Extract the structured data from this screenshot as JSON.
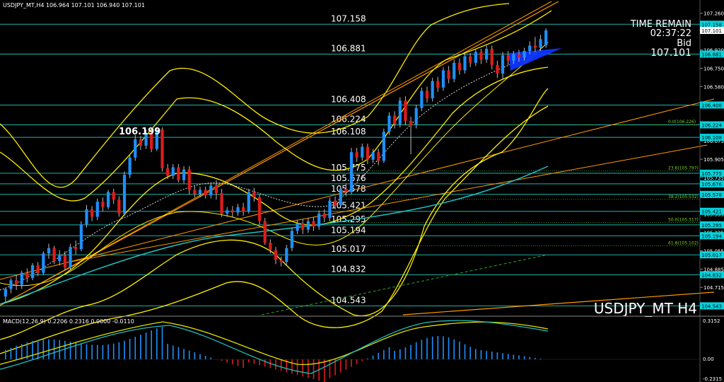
{
  "header": {
    "symbol_info": "USDJPY_MT,H4",
    "ohlc": "106.964 107.101 106.940 107.101"
  },
  "info": {
    "time_remain_label": "TIME REMAIN",
    "time_remain": "02:37:22",
    "bid_label": "Bid",
    "bid": "107.101"
  },
  "watermark": "USDJPY_MT H4",
  "highlight_label": "106.199",
  "macd": {
    "label": "MACD(12,26,9) 0.2206 0.2316 0.0000 -0.0110",
    "axis_labels": [
      "0.3152",
      "0.00",
      "-0.2315"
    ]
  },
  "colors": {
    "background": "#000000",
    "bull": "#1e90ff",
    "bear": "#e01c1c",
    "level": "#20b2aa",
    "bollinger": "#ffee00",
    "trend": "#ff9900",
    "ma": "#1fbfbf",
    "fib": "#7ed321",
    "axis_tag": "#00d5e0",
    "macd_signal": "#e0e000"
  },
  "chart_data": {
    "type": "candlestick",
    "ylim": [
      104.46,
      107.37
    ],
    "axis_labels": [
      "107.260",
      "107.090",
      "106.920",
      "106.750",
      "106.580",
      "106.405",
      "106.245",
      "106.075",
      "105.905",
      "105.735",
      "105.565",
      "105.395",
      "105.225",
      "105.055",
      "104.885",
      "104.715"
    ],
    "levels": [
      {
        "value": "107.158",
        "tag": "107.158"
      },
      {
        "value": "106.881",
        "tag": "106.881"
      },
      {
        "value": "106.408",
        "tag": "106.408"
      },
      {
        "value": "106.224",
        "tag": "106.224"
      },
      {
        "value": "106.108",
        "tag": "106.108"
      },
      {
        "value": "105.775",
        "tag": "105.775"
      },
      {
        "value": "105.676",
        "tag": "105.676"
      },
      {
        "value": "105.578",
        "tag": "105.578"
      },
      {
        "value": "105.421",
        "tag": "105.421"
      },
      {
        "value": "105.295",
        "tag": "105.295"
      },
      {
        "value": "105.194",
        "tag": "105.194"
      },
      {
        "value": "105.017",
        "tag": "105.017"
      },
      {
        "value": "104.832",
        "tag": "104.832"
      },
      {
        "value": "104.543",
        "tag": "104.543"
      }
    ],
    "fib_levels": [
      {
        "label": "0.0(106.226)",
        "value": 106.226
      },
      {
        "label": "23.6(105.797)",
        "value": 105.797
      },
      {
        "label": "38.2(105.532)",
        "value": 105.532
      },
      {
        "label": "50.0(105.317)",
        "value": 105.317
      },
      {
        "label": "61.8(105.102)",
        "value": 105.102
      }
    ],
    "current_price": "107.101",
    "candles": [
      [
        104.63,
        104.7,
        104.57,
        104.71
      ],
      [
        104.7,
        104.78,
        104.66,
        104.8
      ],
      [
        104.78,
        104.74,
        104.69,
        104.83
      ],
      [
        104.74,
        104.85,
        104.7,
        104.87
      ],
      [
        104.85,
        104.8,
        104.76,
        104.89
      ],
      [
        104.8,
        104.92,
        104.78,
        104.94
      ],
      [
        104.92,
        104.85,
        104.82,
        104.95
      ],
      [
        104.85,
        105.03,
        104.83,
        105.05
      ],
      [
        105.03,
        105.08,
        104.98,
        105.12
      ],
      [
        105.08,
        104.96,
        104.93,
        105.1
      ],
      [
        104.96,
        105.01,
        104.92,
        105.06
      ],
      [
        105.01,
        104.9,
        104.87,
        105.05
      ],
      [
        104.9,
        105.09,
        104.88,
        105.12
      ],
      [
        105.09,
        105.07,
        105.02,
        105.15
      ],
      [
        105.07,
        105.3,
        105.05,
        105.33
      ],
      [
        105.3,
        105.44,
        105.27,
        105.48
      ],
      [
        105.44,
        105.37,
        105.33,
        105.47
      ],
      [
        105.37,
        105.51,
        105.34,
        105.54
      ],
      [
        105.51,
        105.46,
        105.42,
        105.55
      ],
      [
        105.46,
        105.6,
        105.44,
        105.62
      ],
      [
        105.6,
        105.53,
        105.49,
        105.63
      ],
      [
        105.53,
        105.4,
        105.37,
        105.56
      ],
      [
        105.4,
        105.76,
        105.38,
        105.79
      ],
      [
        105.76,
        105.92,
        105.73,
        105.95
      ],
      [
        105.92,
        106.09,
        105.89,
        106.13
      ],
      [
        106.09,
        106.03,
        105.99,
        106.12
      ],
      [
        106.03,
        106.15,
        106.0,
        106.18
      ],
      [
        106.15,
        106.0,
        105.97,
        106.17
      ],
      [
        106.0,
        106.18,
        105.98,
        106.2
      ],
      [
        106.18,
        105.82,
        105.79,
        106.2
      ],
      [
        105.82,
        105.75,
        105.72,
        105.86
      ],
      [
        105.75,
        105.83,
        105.72,
        105.86
      ],
      [
        105.83,
        105.71,
        105.69,
        105.86
      ],
      [
        105.71,
        105.81,
        105.68,
        105.84
      ],
      [
        105.81,
        105.62,
        105.58,
        105.84
      ],
      [
        105.62,
        105.58,
        105.55,
        105.66
      ],
      [
        105.58,
        105.62,
        105.55,
        105.65
      ],
      [
        105.62,
        105.57,
        105.54,
        105.65
      ],
      [
        105.57,
        105.66,
        105.54,
        105.68
      ],
      [
        105.66,
        105.59,
        105.53,
        105.71
      ],
      [
        105.59,
        105.4,
        105.37,
        105.63
      ],
      [
        105.4,
        105.43,
        105.37,
        105.46
      ],
      [
        105.43,
        105.41,
        105.37,
        105.47
      ],
      [
        105.41,
        105.46,
        105.38,
        105.49
      ],
      [
        105.46,
        105.42,
        105.38,
        105.5
      ],
      [
        105.42,
        105.6,
        105.4,
        105.63
      ],
      [
        105.6,
        105.55,
        105.51,
        105.64
      ],
      [
        105.55,
        105.33,
        105.3,
        105.58
      ],
      [
        105.33,
        105.13,
        105.11,
        105.36
      ],
      [
        105.13,
        105.06,
        105.03,
        105.16
      ],
      [
        105.06,
        104.97,
        104.93,
        105.09
      ],
      [
        104.97,
        104.95,
        104.91,
        105.0
      ],
      [
        104.95,
        105.08,
        104.92,
        105.11
      ],
      [
        105.08,
        105.24,
        105.05,
        105.27
      ],
      [
        105.24,
        105.31,
        105.21,
        105.34
      ],
      [
        105.31,
        105.25,
        105.21,
        105.35
      ],
      [
        105.25,
        105.33,
        105.22,
        105.36
      ],
      [
        105.33,
        105.28,
        105.24,
        105.37
      ],
      [
        105.28,
        105.4,
        105.25,
        105.43
      ],
      [
        105.4,
        105.36,
        105.32,
        105.44
      ],
      [
        105.36,
        105.52,
        105.33,
        105.55
      ],
      [
        105.52,
        105.48,
        105.44,
        105.56
      ],
      [
        105.48,
        105.63,
        105.45,
        105.66
      ],
      [
        105.63,
        105.6,
        105.56,
        105.68
      ],
      [
        105.6,
        105.97,
        105.58,
        106.01
      ],
      [
        105.97,
        105.92,
        105.88,
        106.01
      ],
      [
        105.92,
        106.02,
        105.89,
        106.05
      ],
      [
        106.02,
        105.9,
        105.86,
        106.05
      ],
      [
        105.9,
        105.97,
        105.87,
        106.0
      ],
      [
        105.97,
        105.89,
        105.85,
        106.0
      ],
      [
        105.89,
        106.16,
        105.87,
        106.19
      ],
      [
        106.16,
        106.31,
        106.13,
        106.34
      ],
      [
        106.31,
        106.23,
        106.19,
        106.35
      ],
      [
        106.23,
        106.45,
        106.2,
        106.48
      ],
      [
        106.45,
        106.26,
        106.22,
        106.49
      ],
      [
        106.26,
        106.22,
        105.95,
        106.3
      ],
      [
        106.22,
        106.38,
        106.19,
        106.41
      ],
      [
        106.38,
        106.54,
        106.35,
        106.57
      ],
      [
        106.54,
        106.47,
        106.43,
        106.58
      ],
      [
        106.47,
        106.63,
        106.44,
        106.66
      ],
      [
        106.63,
        106.57,
        106.53,
        106.67
      ],
      [
        106.57,
        106.73,
        106.54,
        106.76
      ],
      [
        106.73,
        106.65,
        106.61,
        106.77
      ],
      [
        106.65,
        106.8,
        106.62,
        106.83
      ],
      [
        106.8,
        106.73,
        106.69,
        106.84
      ],
      [
        106.73,
        106.86,
        106.7,
        106.89
      ],
      [
        106.86,
        106.8,
        106.76,
        106.89
      ],
      [
        106.8,
        106.9,
        106.77,
        106.93
      ],
      [
        106.9,
        106.83,
        106.79,
        106.93
      ],
      [
        106.83,
        106.93,
        106.8,
        106.96
      ],
      [
        106.93,
        106.78,
        106.74,
        106.96
      ],
      [
        106.78,
        106.7,
        106.66,
        106.82
      ],
      [
        106.7,
        106.87,
        106.64,
        106.9
      ],
      [
        106.87,
        106.82,
        106.78,
        106.91
      ],
      [
        106.82,
        106.88,
        106.79,
        106.91
      ],
      [
        106.88,
        106.85,
        106.81,
        106.92
      ],
      [
        106.85,
        106.91,
        106.82,
        106.94
      ],
      [
        106.91,
        106.96,
        106.88,
        107.0
      ],
      [
        106.96,
        106.94,
        106.9,
        107.04
      ],
      [
        106.94,
        107.02,
        106.91,
        107.06
      ],
      [
        106.964,
        107.101,
        106.94,
        107.12
      ]
    ]
  }
}
